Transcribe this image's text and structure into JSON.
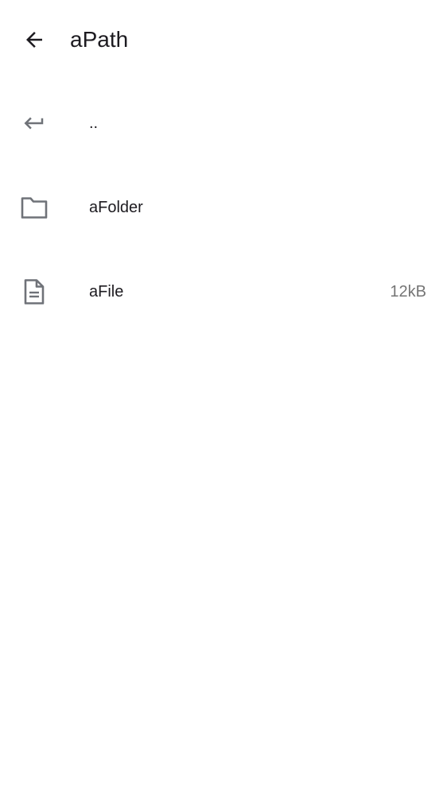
{
  "header": {
    "back_icon": "arrow-left-icon",
    "title": "aPath"
  },
  "entries": [
    {
      "icon": "return-icon",
      "name": "..",
      "size": ""
    },
    {
      "icon": "folder-icon",
      "name": "aFolder",
      "size": ""
    },
    {
      "icon": "file-icon",
      "name": "aFile",
      "size": "12kB"
    }
  ],
  "colors": {
    "text_primary": "#1d1b20",
    "icon_gray": "#6f7278",
    "text_secondary": "#757575",
    "background": "#ffffff"
  }
}
